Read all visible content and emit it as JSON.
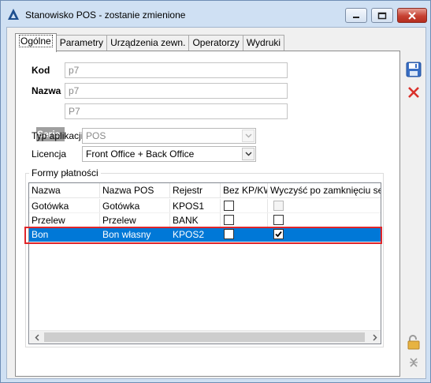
{
  "window": {
    "title": "Stanowisko POS - zostanie zmienione",
    "icons": {
      "app": "comarch-icon",
      "minimize": "minimize-icon",
      "maximize": "maximize-icon",
      "close": "close-icon"
    }
  },
  "tabs": [
    {
      "label": "Ogólne",
      "active": true
    },
    {
      "label": "Parametry",
      "active": false
    },
    {
      "label": "Urządzenia zewn.",
      "active": false
    },
    {
      "label": "Operatorzy",
      "active": false
    },
    {
      "label": "Wydruki",
      "active": false
    }
  ],
  "form": {
    "kod": {
      "label": "Kod",
      "value": "p7"
    },
    "nazwa": {
      "label": "Nazwa",
      "value": "p7"
    },
    "seria": {
      "label": "Seria",
      "value": "P7"
    },
    "typ": {
      "label": "Typ aplikacji",
      "value": "POS",
      "enabled": false
    },
    "licencja": {
      "label": "Licencja",
      "value": "Front Office + Back Office",
      "enabled": true
    }
  },
  "payments": {
    "title": "Formy płatności",
    "columns": [
      "Nazwa",
      "Nazwa POS",
      "Rejestr",
      "Bez KP/KW",
      "Wyczyść po zamknięciu sesji"
    ],
    "rows": [
      {
        "nazwa": "Gotówka",
        "nazwa_pos": "Gotówka",
        "rejestr": "KPOS1",
        "bez_kp_kw": false,
        "wyczysc": false,
        "wyczysc_enabled": false,
        "selected": false
      },
      {
        "nazwa": "Przelew",
        "nazwa_pos": "Przelew",
        "rejestr": "BANK",
        "bez_kp_kw": false,
        "wyczysc": false,
        "wyczysc_enabled": true,
        "selected": false
      },
      {
        "nazwa": "Bon",
        "nazwa_pos": "Bon własny",
        "rejestr": "KPOS2",
        "bez_kp_kw": false,
        "wyczysc": true,
        "wyczysc_enabled": true,
        "selected": true
      }
    ]
  },
  "side_buttons": {
    "save": "save-icon",
    "cancel": "cancel-icon",
    "lock": "lock-icon",
    "collapse": "collapse-icon"
  },
  "colors": {
    "selection": "#0078d7",
    "highlight_border": "#e0262a",
    "titlebar": "#cfe0f3"
  }
}
